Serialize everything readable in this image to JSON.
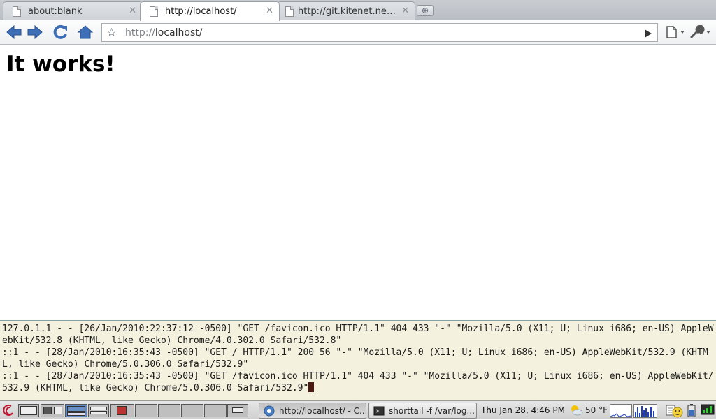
{
  "tabs": [
    {
      "title": "about:blank",
      "active": false
    },
    {
      "title": "http://localhost/",
      "active": true
    },
    {
      "title": "http://git.kitenet.net...",
      "active": false
    }
  ],
  "omnibox": {
    "scheme": "http://",
    "host": "localhost/"
  },
  "page": {
    "heading": "It works!"
  },
  "terminal": {
    "lines": [
      "127.0.1.1 - - [26/Jan/2010:22:37:12 -0500] \"GET /favicon.ico HTTP/1.1\" 404 433 \"-\" \"Mozilla/5.0 (X11; U; Linux i686; en-US) AppleWebKit/532.8 (KHTML, like Gecko) Chrome/4.0.302.0 Safari/532.8\"",
      "::1 - - [28/Jan/2010:16:35:43 -0500] \"GET / HTTP/1.1\" 200 56 \"-\" \"Mozilla/5.0 (X11; U; Linux i686; en-US) AppleWebKit/532.9 (KHTML, like Gecko) Chrome/5.0.306.0 Safari/532.9\"",
      "::1 - - [28/Jan/2010:16:35:43 -0500] \"GET /favicon.ico HTTP/1.1\" 404 433 \"-\" \"Mozilla/5.0 (X11; U; Linux i686; en-US) AppleWebKit/532.9 (KHTML, like Gecko) Chrome/5.0.306.0 Safari/532.9\""
    ]
  },
  "panel": {
    "tasks": [
      {
        "label": "http://localhost/ - C...",
        "icon": "chrome-icon"
      },
      {
        "label": "shorttail -f /var/log...",
        "icon": "terminal-icon"
      }
    ],
    "clock": "Thu Jan 28,  4:46 PM",
    "temperature": "50 °F"
  },
  "colors": {
    "terminal_bg": "#f4f1de",
    "terminal_fg": "#1b1b1b",
    "toolbar_icon_blue": "#3d6fb6",
    "workspace_selected": "#5f87c2"
  }
}
